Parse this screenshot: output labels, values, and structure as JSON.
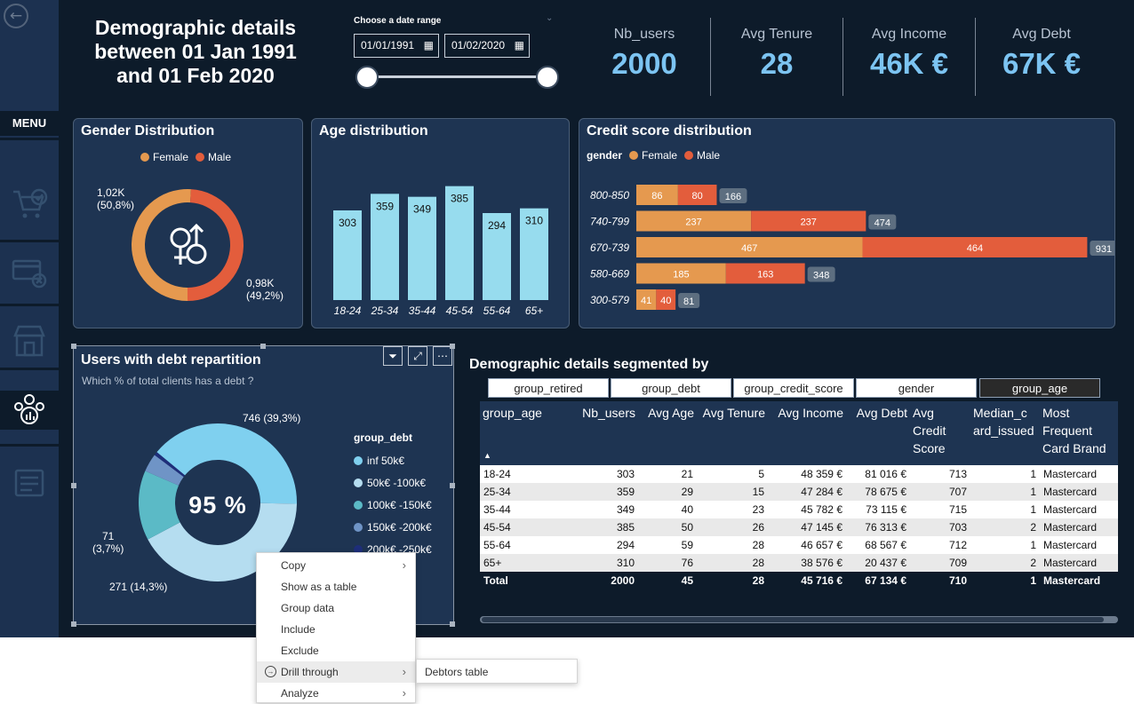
{
  "header": {
    "title_lines": [
      "Demographic details",
      "between 01 Jan 1991",
      "and 01 Feb 2020"
    ],
    "date_range_label": "Choose a date range",
    "date_start": "01/01/1991",
    "date_end": "01/02/2020"
  },
  "sidebar": {
    "menu_label": "MENU"
  },
  "kpis": [
    {
      "label": "Nb_users",
      "value": "2000"
    },
    {
      "label": "Avg Tenure",
      "value": "28"
    },
    {
      "label": "Avg Income",
      "value": "46K €"
    },
    {
      "label": "Avg Debt",
      "value": "67K €"
    }
  ],
  "colors": {
    "female": "#e5994f",
    "male": "#e35d3c",
    "bar": "#97dcee",
    "total_badge": "#5d6e80"
  },
  "gender_panel": {
    "title": "Gender Distribution",
    "legend": [
      "Female",
      "Male"
    ],
    "female_label_1": "1,02K",
    "female_label_2": "(50,8%)",
    "male_label_1": "0,98K",
    "male_label_2": "(49,2%)"
  },
  "age_panel": {
    "title": "Age distribution"
  },
  "credit_panel": {
    "title": "Credit score distribution",
    "legend_title": "gender",
    "legend": [
      "Female",
      "Male"
    ]
  },
  "debt_panel": {
    "title": "Users with debt repartition",
    "subtitle": "Which % of total clients has a debt ?",
    "center_value": "95 %",
    "legend_title": "group_debt",
    "legend": [
      "inf 50k€",
      "50k€ -100k€",
      "100k€ -150k€",
      "150k€ -200k€",
      "200k€ -250k€"
    ],
    "label_top": "746 (39,3%)",
    "label_left_1": "71",
    "label_left_2": "(3,7%)",
    "label_bottom": "271 (14,3%)"
  },
  "chart_data": [
    {
      "type": "pie",
      "title": "Gender Distribution",
      "categories": [
        "Female",
        "Male"
      ],
      "values": [
        1020,
        980
      ],
      "percent": [
        50.8,
        49.2
      ]
    },
    {
      "type": "bar",
      "title": "Age distribution",
      "categories": [
        "18-24",
        "25-34",
        "35-44",
        "45-54",
        "55-64",
        "65+"
      ],
      "values": [
        303,
        359,
        349,
        385,
        294,
        310
      ]
    },
    {
      "type": "bar",
      "title": "Credit score distribution",
      "orientation": "horizontal",
      "stacked": true,
      "categories": [
        "800-850",
        "740-799",
        "670-739",
        "580-669",
        "300-579"
      ],
      "series": [
        {
          "name": "Female",
          "values": [
            86,
            237,
            467,
            185,
            41
          ]
        },
        {
          "name": "Male",
          "values": [
            80,
            237,
            464,
            163,
            40
          ]
        }
      ],
      "totals": [
        166,
        474,
        931,
        348,
        81
      ]
    },
    {
      "type": "pie",
      "title": "Users with debt repartition",
      "categories": [
        "inf 50k€",
        "50k€ -100k€",
        "100k€ -150k€",
        "150k€ -200k€",
        "200k€ -250k€"
      ],
      "values": [
        746,
        798,
        271,
        71,
        14
      ],
      "center_label": "95 %"
    }
  ],
  "table_section": {
    "title": "Demographic details segmented by",
    "tabs": [
      "group_retired",
      "group_debt",
      "group_credit_score",
      "gender",
      "group_age"
    ],
    "selected_tab": "group_age",
    "columns": [
      "group_age",
      "Nb_users",
      "Avg Age",
      "Avg Tenure",
      "Avg Income",
      "Avg Debt",
      "Avg Credit Score",
      "Median_card_issued",
      "Most Frequent Card Brand"
    ],
    "column_display": [
      "group_age",
      "Nb_users",
      "Avg Age",
      "Avg Tenure",
      "Avg Income",
      "Avg Debt",
      "Avg\nCredit\nScore",
      "Median_c\nard_issued",
      "Most\nFrequent\nCard Brand"
    ],
    "rows": [
      [
        "18-24",
        "303",
        "21",
        "5",
        "48 359 €",
        "81 016 €",
        "713",
        "1",
        "Mastercard"
      ],
      [
        "25-34",
        "359",
        "29",
        "15",
        "47 284 €",
        "78 675 €",
        "707",
        "1",
        "Mastercard"
      ],
      [
        "35-44",
        "349",
        "40",
        "23",
        "45 782 €",
        "73 115 €",
        "715",
        "1",
        "Mastercard"
      ],
      [
        "45-54",
        "385",
        "50",
        "26",
        "47 145 €",
        "76 313 €",
        "703",
        "2",
        "Mastercard"
      ],
      [
        "55-64",
        "294",
        "59",
        "28",
        "46 657 €",
        "68 567 €",
        "712",
        "1",
        "Mastercard"
      ],
      [
        "65+",
        "310",
        "76",
        "28",
        "38 576 €",
        "20 437 €",
        "709",
        "2",
        "Mastercard"
      ]
    ],
    "total": [
      "Total",
      "2000",
      "45",
      "28",
      "45 716 €",
      "67 134 €",
      "710",
      "1",
      "Mastercard"
    ]
  },
  "context_menu": {
    "items": [
      "Copy",
      "Show as a table",
      "Group data",
      "Include",
      "Exclude",
      "Drill through",
      "Analyze"
    ],
    "submenu": "Debtors table"
  }
}
